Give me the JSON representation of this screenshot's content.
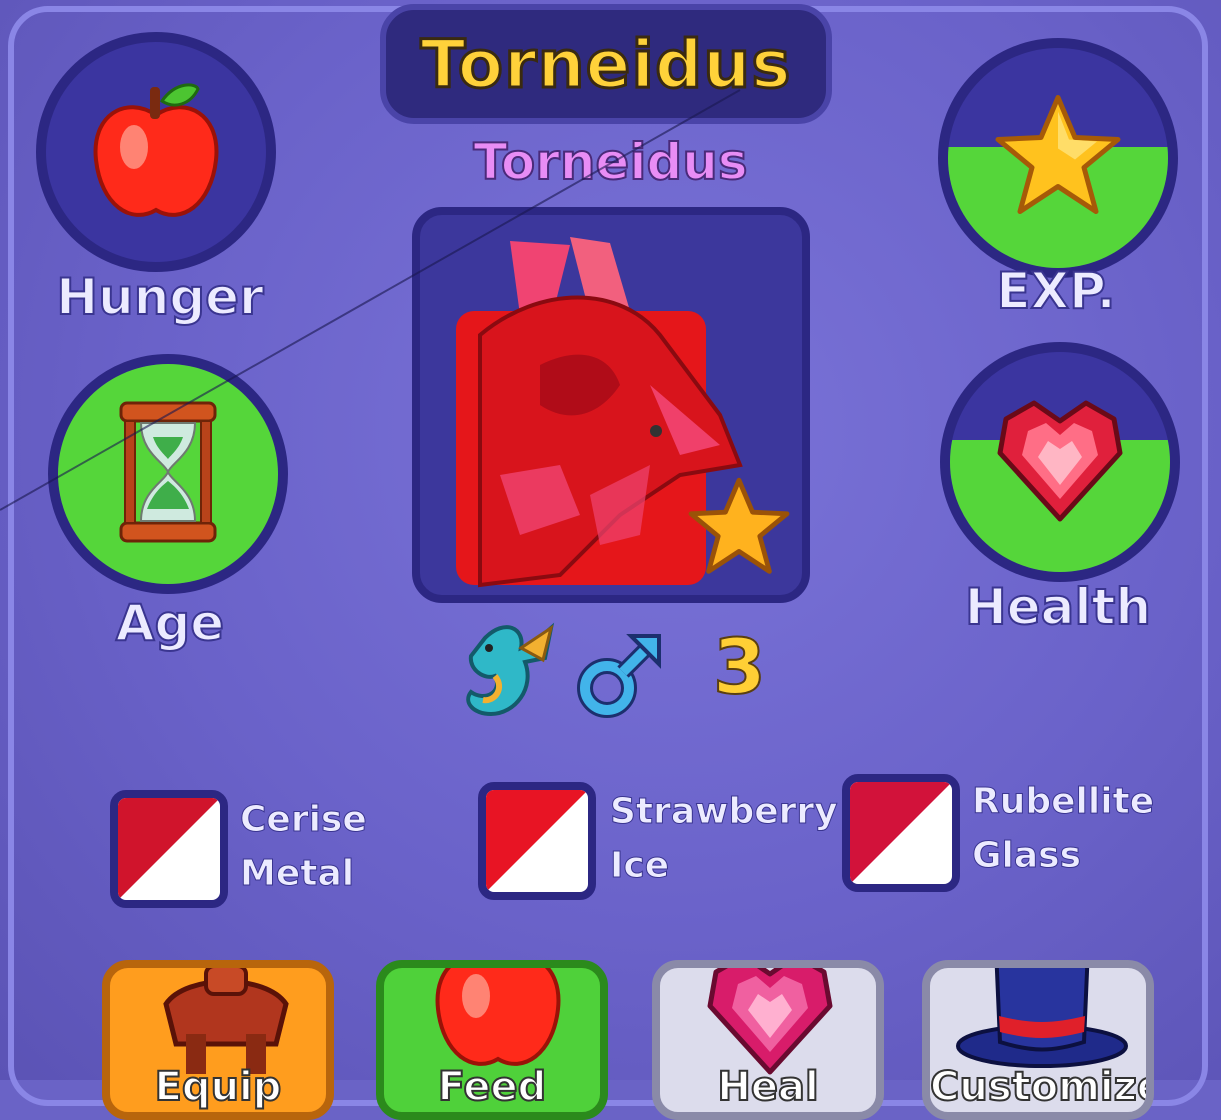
{
  "header": {
    "title": "Torneidus",
    "subtitle": "Torneidus"
  },
  "stats": {
    "hunger": {
      "label": "Hunger",
      "icon": "apple-icon",
      "fill_fraction": 0.0
    },
    "exp": {
      "label": "EXP.",
      "icon": "star-icon",
      "fill_fraction": 0.55
    },
    "age": {
      "label": "Age",
      "icon": "hourglass-icon",
      "fill_fraction": 1.0
    },
    "health": {
      "label": "Health",
      "icon": "heart-gem-icon",
      "fill_fraction": 0.6
    }
  },
  "dragon": {
    "level": "3",
    "gender_icon": "male-icon",
    "species_icon": "dragon-icon"
  },
  "colors": [
    {
      "line1": "Cerise",
      "line2": "Metal",
      "hex": "#d0142c"
    },
    {
      "line1": "Strawberry",
      "line2": "Ice",
      "hex": "#e81424"
    },
    {
      "line1": "Rubellite",
      "line2": "Glass",
      "hex": "#d2123a"
    }
  ],
  "actions": [
    {
      "label": "Equip",
      "icon": "saddle-icon",
      "color": "#ff9d1e"
    },
    {
      "label": "Feed",
      "icon": "apple-icon",
      "color": "#4fd13a"
    },
    {
      "label": "Heal",
      "icon": "heart-gem-icon",
      "color": "#dcdcec"
    },
    {
      "label": "Customize",
      "icon": "top-hat-icon",
      "color": "#dcdcec"
    }
  ],
  "palette": {
    "accent_gold": "#ffd23a",
    "bar_green": "#55d63a",
    "panel": "#6a63c6",
    "subtitle_pink": "#e88df5"
  }
}
